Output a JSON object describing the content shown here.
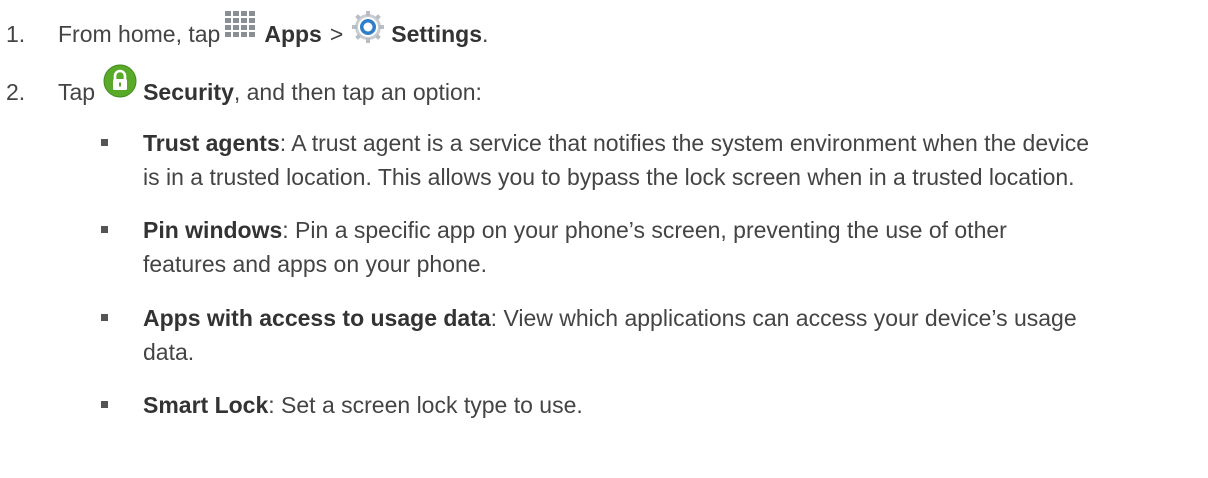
{
  "steps": [
    {
      "number": "1.",
      "text_a": "From home, tap",
      "icon1": "apps-grid-icon",
      "label1": "Apps",
      "sep": ">",
      "icon2": "settings-gear-icon",
      "label2": "Settings",
      "end": "."
    },
    {
      "number": "2.",
      "text_a": "Tap",
      "icon1": "security-lock-icon",
      "label1": "Security",
      "rest": ", and then tap an option:"
    }
  ],
  "options": [
    {
      "title": "Trust agents",
      "desc_line1": ": A trust agent is a service that notifies the system environment when the device",
      "desc_line2": "is in a trusted location. This allows you to bypass the lock screen when in a trusted location."
    },
    {
      "title": "Pin windows",
      "desc_line1": ": Pin a specific app on your phone’s screen, preventing the use of other",
      "desc_line2": "features and apps on your phone."
    },
    {
      "title": "Apps with access to usage data",
      "desc_line1": ": View which applications can access your device’s usage",
      "desc_line2": "data."
    },
    {
      "title": "Smart Lock",
      "desc_line1": ": Set a screen lock type to use."
    }
  ],
  "colors": {
    "text": "#444444",
    "security_green": "#5aaa2a",
    "settings_blue": "#2f7ec8"
  }
}
